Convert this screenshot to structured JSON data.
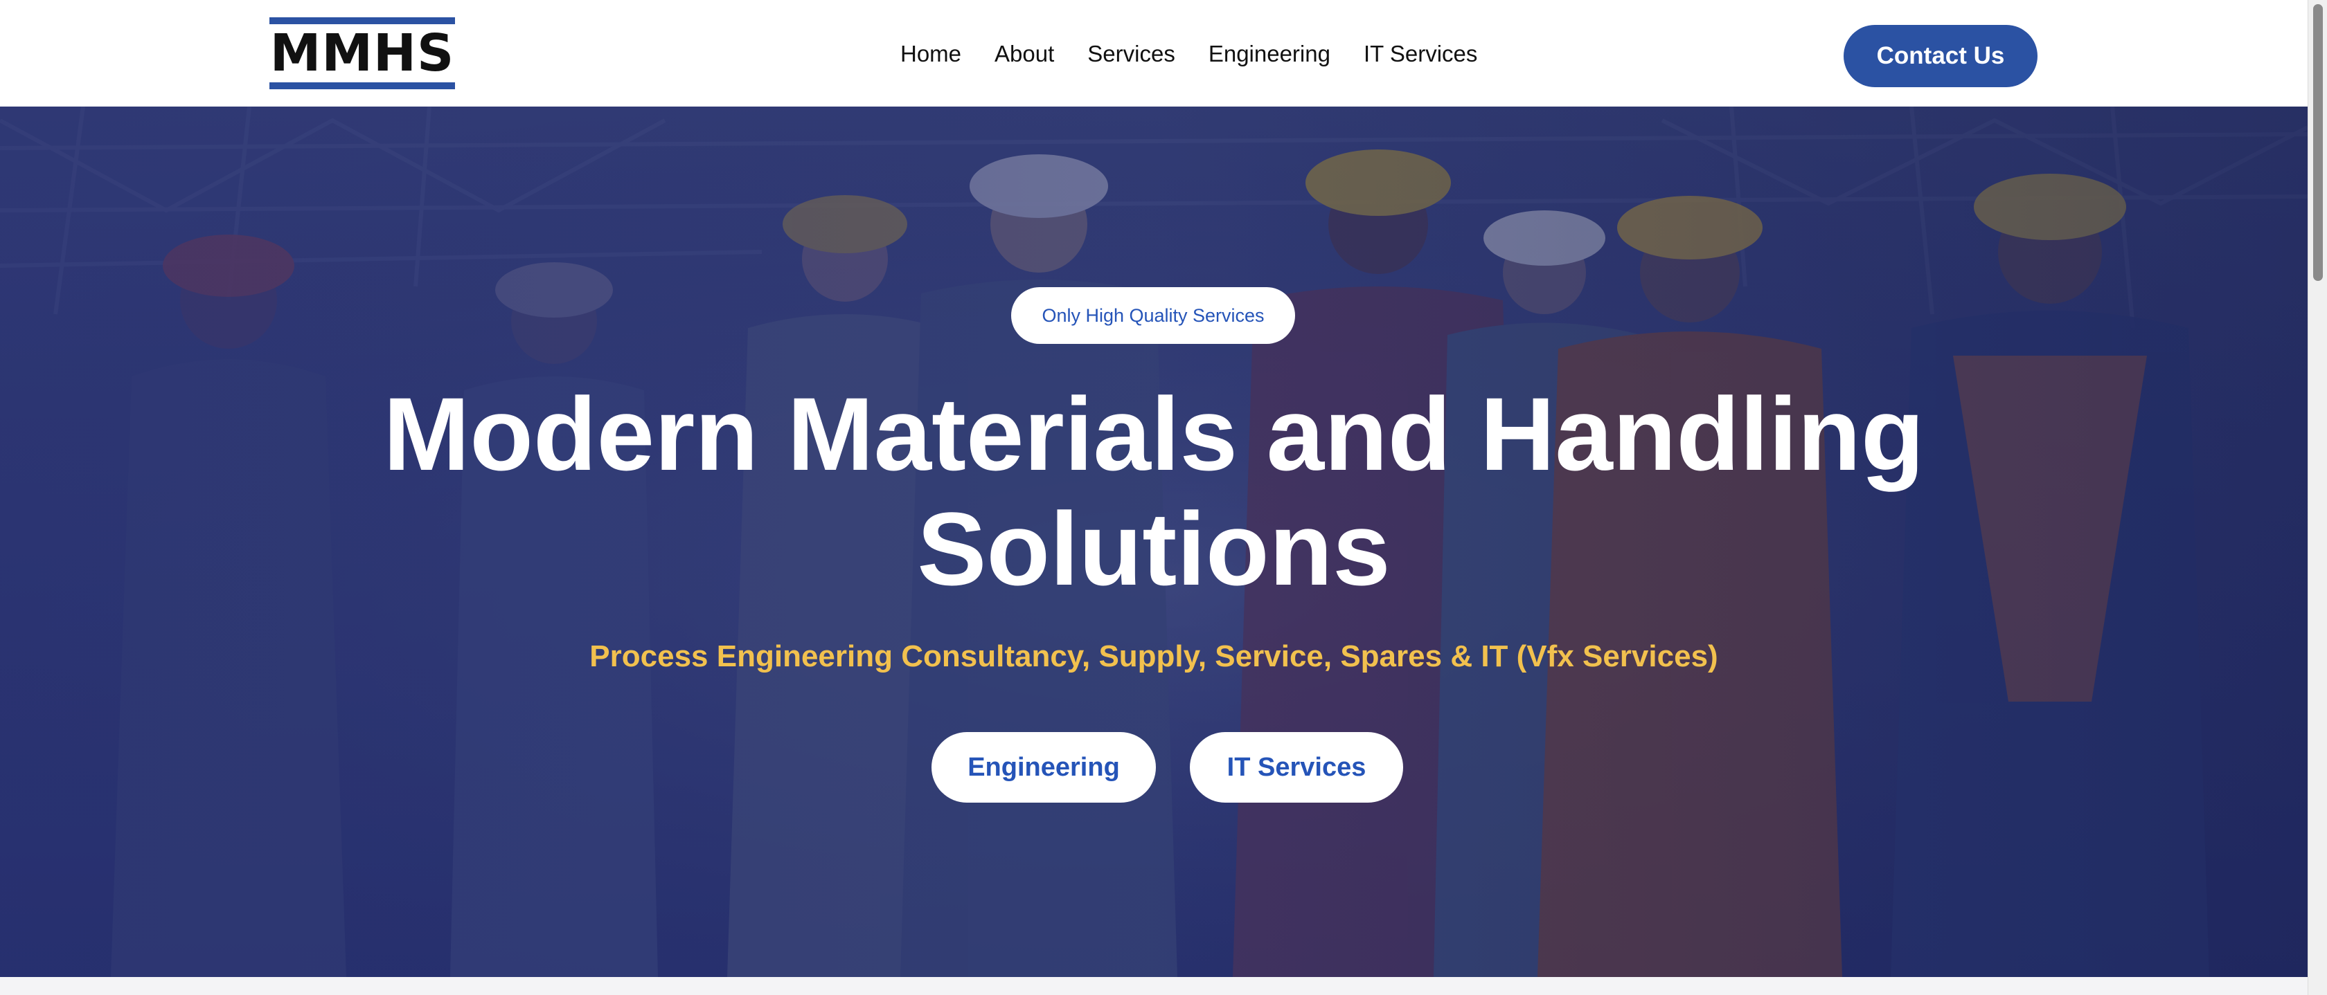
{
  "header": {
    "logo_text": "MMHS",
    "nav": [
      {
        "label": "Home"
      },
      {
        "label": "About"
      },
      {
        "label": "Services"
      },
      {
        "label": "Engineering"
      },
      {
        "label": "IT Services"
      }
    ],
    "contact_label": "Contact Us"
  },
  "hero": {
    "badge": "Only High Quality Services",
    "title_line1": "Modern Materials and Handling",
    "title_line2": "Solutions",
    "subtitle": "Process Engineering Consultancy, Supply, Service, Spares & IT (Vfx Services)",
    "buttons": [
      {
        "label": "Engineering"
      },
      {
        "label": "IT Services"
      }
    ],
    "background": "industrial-workers-team-photo"
  },
  "colors": {
    "brand_blue": "#2b52a3",
    "accent_blue": "#2554b8",
    "subtitle_yellow": "#f2c14e",
    "overlay_navy": "#2a3370"
  }
}
